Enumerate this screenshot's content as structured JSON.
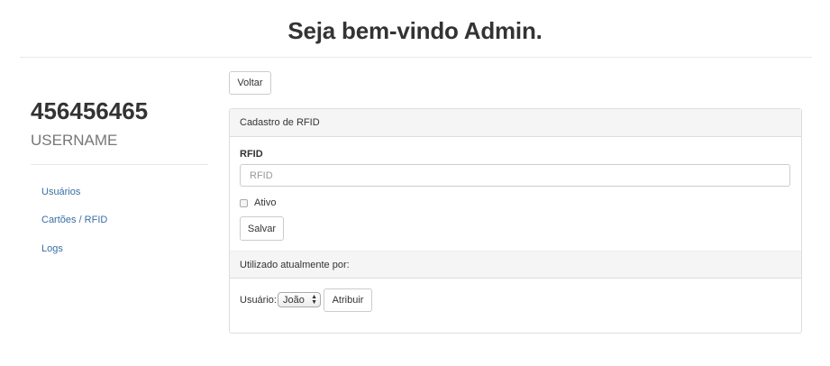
{
  "header": {
    "title": "Seja bem-vindo Admin."
  },
  "sidebar": {
    "user_id": "456456465",
    "username": "USERNAME",
    "items": [
      {
        "label": "Usuários"
      },
      {
        "label": "Cartões / RFID"
      },
      {
        "label": "Logs"
      }
    ]
  },
  "toolbar": {
    "back_label": "Voltar"
  },
  "panel": {
    "heading": "Cadastro de RFID",
    "rfid_label": "RFID",
    "rfid_placeholder": "RFID",
    "rfid_value": "",
    "active_label": "Ativo",
    "active_checked": false,
    "save_label": "Salvar",
    "usage_heading": "Utilizado atualmente por:",
    "user_label": "Usuário:",
    "user_selected": "João",
    "assign_label": "Atribuir"
  },
  "icons": {
    "select_arrows": "up-down-arrows-icon"
  }
}
